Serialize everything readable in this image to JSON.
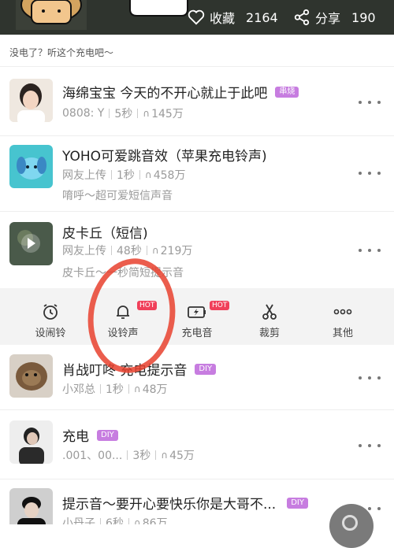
{
  "header": {
    "favorite_label": "收藏",
    "favorite_count": "2164",
    "share_label": "分享",
    "share_count": "190"
  },
  "subtitle": "没电了？听这个充电吧～",
  "rows_top": [
    {
      "title": "海绵宝宝 今天的不开心就止于此吧",
      "badge": "串烧",
      "author": "0808: Y",
      "duration": "5秒",
      "plays": "145万",
      "desc": ""
    },
    {
      "title": "YOHO可爱跳音效（苹果充电铃声)",
      "badge": "",
      "author": "网友上传",
      "duration": "1秒",
      "plays": "458万",
      "desc": "唷呼～超可爱短信声音"
    },
    {
      "title": "皮卡丘（短信)",
      "badge": "",
      "author": "网友上传",
      "duration": "48秒",
      "plays": "219万",
      "desc": "皮卡丘～一秒简短提示音"
    }
  ],
  "toolbar": {
    "items": [
      {
        "label": "设闹铃",
        "hot": ""
      },
      {
        "label": "设铃声",
        "hot": "HOT"
      },
      {
        "label": "充电音",
        "hot": "HOT"
      },
      {
        "label": "裁剪",
        "hot": ""
      },
      {
        "label": "其他",
        "hot": ""
      }
    ]
  },
  "rows_bottom": [
    {
      "title": "肖战叮咚 充电提示音",
      "badge": "DIY",
      "author": "小邓总",
      "duration": "1秒",
      "plays": "48万"
    },
    {
      "title": "充电",
      "badge": "DIY",
      "author": ".001、00...",
      "duration": "3秒",
      "plays": "45万"
    },
    {
      "title": "提示音～要开心要快乐你是大哥不...",
      "badge": "DIY",
      "author": "小丹子",
      "duration": "6秒",
      "plays": "86万"
    }
  ],
  "colors": {
    "header_bg": "#2f342e",
    "badge_purple": "#c77de0",
    "hot_red": "#f0405a",
    "annotation_red": "#e8412e"
  }
}
